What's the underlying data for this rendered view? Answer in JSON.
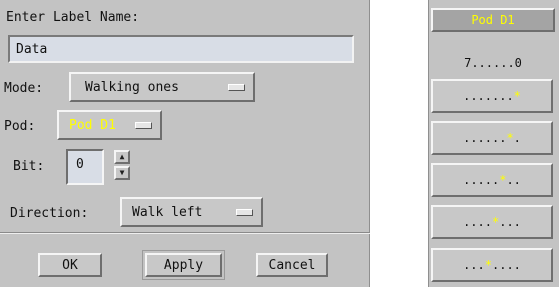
{
  "dialog": {
    "title_label": "Enter Label Name:",
    "label_name_value": "Data",
    "mode": {
      "label": "Mode:",
      "value": "Walking ones"
    },
    "pod": {
      "label": "Pod:",
      "value": "Pod D1"
    },
    "bit": {
      "label": "Bit:",
      "value": "0"
    },
    "direction": {
      "label": "Direction:",
      "value": "Walk left"
    },
    "buttons": {
      "ok": "OK",
      "apply": "Apply",
      "cancel": "Cancel"
    }
  },
  "pod_panel": {
    "title": "Pod D1",
    "bits_header": "7......0",
    "patterns": [
      {
        "before": ".......",
        "star": "*",
        "after": ""
      },
      {
        "before": "......",
        "star": "*",
        "after": "."
      },
      {
        "before": ".....",
        "star": "*",
        "after": ".."
      },
      {
        "before": "....",
        "star": "*",
        "after": "..."
      },
      {
        "before": "...",
        "star": "*",
        "after": "...."
      }
    ]
  },
  "colors": {
    "panel_bg": "#c3c3c3",
    "field_bg": "#d8dde6",
    "highlight_text": "#ffff00"
  }
}
